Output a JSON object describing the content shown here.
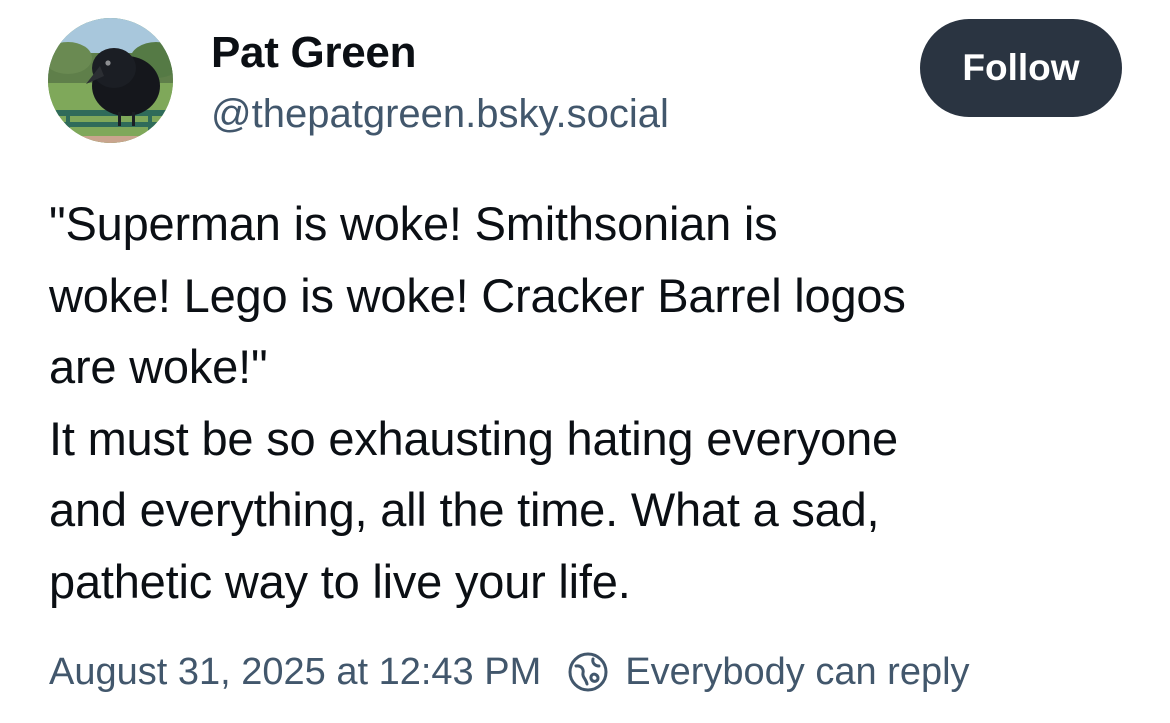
{
  "author": {
    "display_name": "Pat Green",
    "handle": "@thepatgreen.bsky.social",
    "avatar_icon": "crow-photo-avatar"
  },
  "follow_button": {
    "label": "Follow",
    "background": "#2a3441",
    "text_color": "#ffffff"
  },
  "post": {
    "text": "\"Superman is woke! Smithsonian is\nwoke! Lego is woke! Cracker Barrel logos\nare woke!\"\nIt must be so exhausting hating everyone\nand everything, all the time. What a sad,\npathetic way to live your life."
  },
  "meta": {
    "timestamp": "August 31, 2025 at 12:43 PM",
    "reply_setting_label": "Everybody can reply",
    "reply_setting_icon": "globe-icon"
  },
  "colors": {
    "text_primary": "#0b0f14",
    "text_secondary": "#42576c"
  }
}
